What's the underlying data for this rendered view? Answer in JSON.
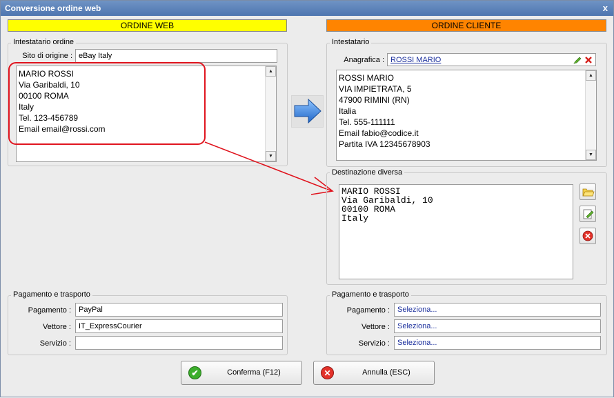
{
  "window": {
    "title": "Conversione ordine web",
    "close_glyph": "x"
  },
  "web": {
    "header": "ORDINE WEB",
    "intestatario": {
      "group_title": "Intestatario ordine",
      "sito_label": "Sito di origine :",
      "sito_value": "eBay Italy",
      "address_lines": [
        "MARIO ROSSI",
        "Via Garibaldi, 10",
        "00100 ROMA",
        "Italy",
        "Tel. 123-456789",
        "Email email@rossi.com"
      ]
    },
    "pagamento": {
      "group_title": "Pagamento e trasporto",
      "pagamento_label": "Pagamento :",
      "pagamento_value": "PayPal",
      "vettore_label": "Vettore :",
      "vettore_value": "IT_ExpressCourier",
      "servizio_label": "Servizio :",
      "servizio_value": ""
    }
  },
  "cliente": {
    "header": "ORDINE CLIENTE",
    "intestatario": {
      "group_title": "Intestatario",
      "anagrafica_label": "Anagrafica :",
      "anagrafica_value": "ROSSI MARIO",
      "address_lines": [
        "ROSSI MARIO",
        "VIA IMPIETRATA, 5",
        "47900 RIMINI (RN)",
        "Italia",
        "Tel. 555-111111",
        "Email fabio@codice.it",
        "Partita IVA 12345678903"
      ]
    },
    "destinazione": {
      "group_title": "Destinazione diversa",
      "address_lines": [
        "MARIO ROSSI",
        "Via Garibaldi, 10",
        "00100 ROMA",
        "Italy"
      ]
    },
    "pagamento": {
      "group_title": "Pagamento e trasporto",
      "pagamento_label": "Pagamento :",
      "pagamento_value": "Seleziona...",
      "vettore_label": "Vettore :",
      "vettore_value": "Seleziona...",
      "servizio_label": "Servizio :",
      "servizio_value": "Seleziona..."
    }
  },
  "buttons": {
    "confirm_label": "Conferma (F12)",
    "cancel_label": "Annulla (ESC)"
  },
  "colors": {
    "web_header": "#ffff00",
    "cliente_header": "#ff8400",
    "highlight": "#e0141e",
    "arrow_blue": "#2d7fe0"
  },
  "icons": [
    "close-icon",
    "scroll-up-icon",
    "scroll-down-icon",
    "convert-arrow-icon",
    "edit-pencil-icon",
    "delete-x-icon",
    "open-folder-icon",
    "edit-note-icon",
    "remove-icon",
    "confirm-check-icon",
    "cancel-x-icon"
  ]
}
